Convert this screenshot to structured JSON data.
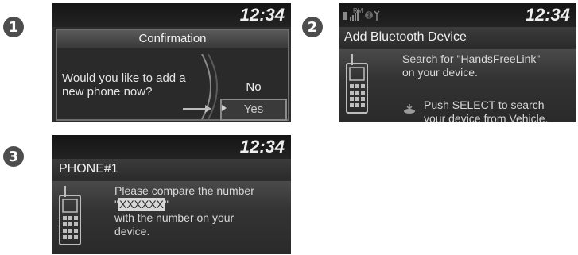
{
  "steps": [
    {
      "number": "1"
    },
    {
      "number": "2"
    },
    {
      "number": "3"
    }
  ],
  "screen1": {
    "clock": "12:34",
    "dialog_title": "Confirmation",
    "message_lines": [
      "Would you like to add a",
      "new phone now?"
    ],
    "option_no": "No",
    "option_yes": "Yes"
  },
  "screen2": {
    "status_icons": [
      "battery-icon",
      "signal-icon",
      "roaming-icon",
      "bluetooth-icon",
      "antenna-icon"
    ],
    "status_text": "RM",
    "clock": "12:34",
    "title": "Add Bluetooth Device",
    "search_lines": [
      "Search for \"HandsFreeLink\"",
      "on your device."
    ],
    "push_lines": [
      "Push SELECT to search",
      "your device from Vehicle."
    ]
  },
  "screen3": {
    "clock": "12:34",
    "title": "PHONE#1",
    "line1": "Please compare the number",
    "quote_open": "\"",
    "code": "XXXXXX",
    "quote_close": "\"",
    "line3": "with the number on your",
    "line4": "device."
  },
  "colors": {
    "screen_bg": "#2e2e2e",
    "text": "#d8d8d8",
    "badge": "#4d4d4d"
  }
}
